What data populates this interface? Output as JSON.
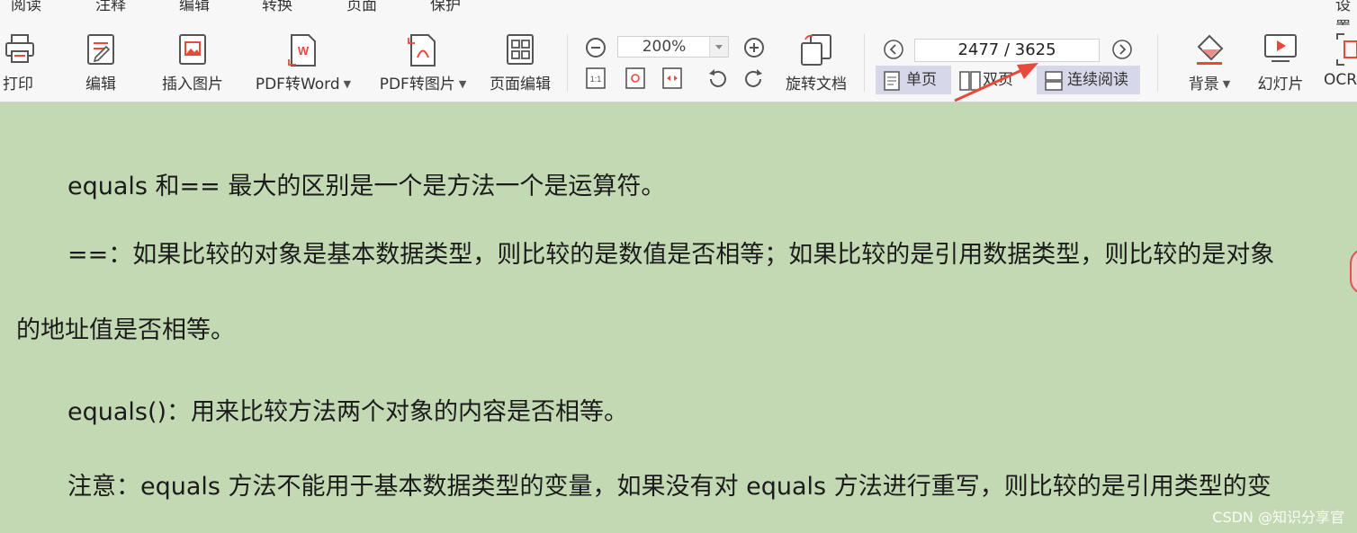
{
  "menubar": {
    "items": [
      "阅读",
      "注释",
      "编辑",
      "转换",
      "页面",
      "保护"
    ],
    "right": "设置"
  },
  "toolbar": {
    "print": "打印",
    "edit": "编辑",
    "insert_image": "插入图片",
    "pdf_to_word": "PDF转Word",
    "pdf_to_image": "PDF转图片",
    "page_edit": "页面编辑",
    "zoom_value": "200%",
    "rotate_doc": "旋转文档",
    "page_indicator": "2477 / 3625",
    "single_page": "单页",
    "double_page": "双页",
    "continuous_reading": "连续阅读",
    "background": "背景",
    "slideshow": "幻灯片",
    "ocr": "OCR"
  },
  "content": {
    "p1": "equals 和== 最大的区别是一个是方法一个是运算符。",
    "p2a": "==：如果比较的对象是基本数据类型，则比较的是数值是否相等；如果比较的是引用数据类型，则比较的是对象",
    "p2b": "的地址值是否相等。",
    "p3": "equals()：用来比较方法两个对象的内容是否相等。",
    "p4": "注意：equals 方法不能用于基本数据类型的变量，如果没有对 equals  方法进行重写，则比较的是引用类型的变"
  },
  "watermark": "CSDN @知识分享官",
  "colors": {
    "page_bg": "#c3d9b3",
    "toolbar_bg": "#f7f7f7",
    "accent_red": "#e8493b",
    "active_mode": "#d6d8ea"
  }
}
